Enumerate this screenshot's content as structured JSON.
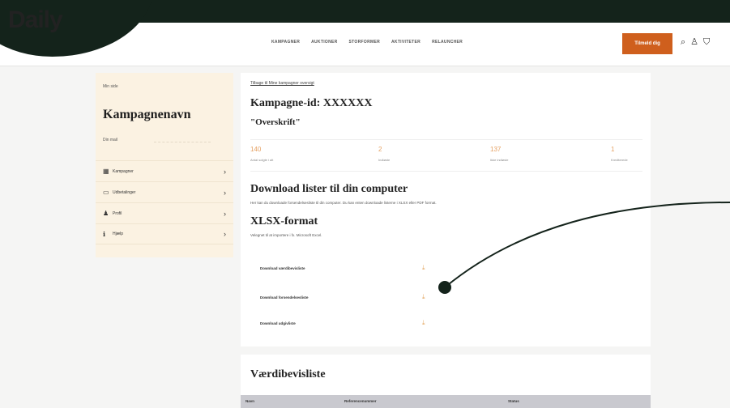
{
  "brand": {
    "logo": "Daily"
  },
  "nav": {
    "items": [
      "KAMPAGNER",
      "AUKTIONER",
      "STORFORMER",
      "AKTIVITETER",
      "RELAUNCHER"
    ]
  },
  "header": {
    "cta_label": "Tilmeld dig"
  },
  "sidebar": {
    "page_label": "Min side",
    "campaign_name": "Kampagnenavn",
    "mail_label": "Din mail",
    "items": [
      {
        "label": "Kampagner",
        "icon": "grid-icon"
      },
      {
        "label": "Udbetalinger",
        "icon": "card-icon"
      },
      {
        "label": "Profil",
        "icon": "person-icon"
      },
      {
        "label": "Hjælp",
        "icon": "info-icon"
      }
    ]
  },
  "main": {
    "back_link": "Tilbage til Mine kampagner oversigt",
    "campaign_id": "Kampagne-id: XXXXXX",
    "headline": "\"Overskrift\"",
    "stats": [
      {
        "value": "140",
        "label": "Antal solgte i alt"
      },
      {
        "value": "2",
        "label": "Indløste"
      },
      {
        "value": "137",
        "label": "Ikke indløste"
      },
      {
        "value": "1",
        "label": "Krediterede"
      }
    ],
    "download_title": "Download lister til din computer",
    "download_desc": "Her kan du downloade forsendelsesliste til din computer. Du kan enten downloade listerne i XLSX eller PDF format.",
    "xlsx_title": "XLSX-format",
    "xlsx_desc": "Velegnet til at importere i fx. Microsoft Excel.",
    "downloads": [
      {
        "label": "Download værdibevisliste"
      },
      {
        "label": "Download forsendelsesliste"
      },
      {
        "label": "Download udgivliste"
      }
    ]
  },
  "list_panel": {
    "title": "Værdibevisliste",
    "columns": [
      "Navn",
      "Referencenummer",
      "Status"
    ]
  },
  "colors": {
    "brand_dark": "#14231b",
    "accent": "#cf5f1d",
    "sidebar_bg": "#fbf2e2",
    "stat_value": "#e5a163"
  }
}
